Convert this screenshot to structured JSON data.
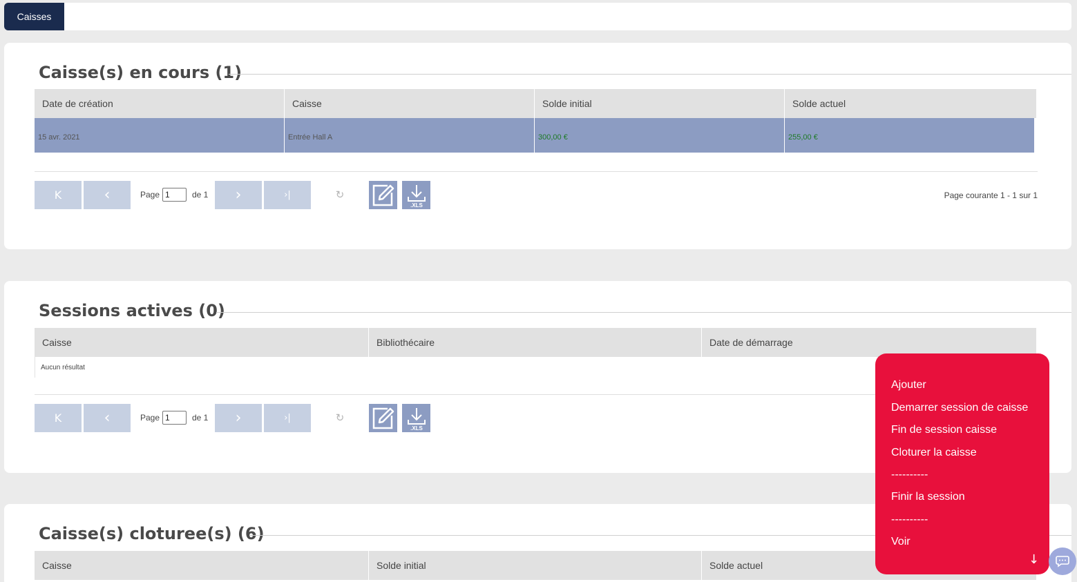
{
  "topbar": {
    "tab_label": "Caisses"
  },
  "panel1": {
    "title": "Caisse(s) en cours (1)",
    "columns": [
      "Date de création",
      "Caisse",
      "Solde initial",
      "Solde actuel"
    ],
    "rows": [
      [
        "15 avr. 2021",
        "Entrée Hall A",
        "300,00 €",
        "255,00 €"
      ]
    ],
    "pager": {
      "page_label": "Page",
      "page_value": "1",
      "of_label": "de 1",
      "info": "Page courante 1 - 1 sur 1"
    }
  },
  "panel2": {
    "title": "Sessions actives (0)",
    "columns": [
      "Caisse",
      "Bibliothécaire",
      "Date de démarrage"
    ],
    "empty_text": "Aucun résultat",
    "pager": {
      "page_label": "Page",
      "page_value": "1",
      "of_label": "de 1"
    }
  },
  "panel3": {
    "title": "Caisse(s) cloturee(s) (6)",
    "columns": [
      "Caisse",
      "Solde initial",
      "Solde actuel"
    ]
  },
  "pager_icons": {
    "first": "K",
    "prev": "‹",
    "next": "›",
    "last": "›|",
    "refresh": "↻",
    "xls_label": ".XLS"
  },
  "context_menu": {
    "items": [
      "Ajouter",
      "Demarrer session de caisse",
      "Fin de session caisse",
      "Cloturer la caisse",
      "----------",
      "Finir la session",
      "----------",
      "Voir"
    ],
    "scroll_icon": "↓"
  },
  "colors": {
    "tab_active": "#1a2b4e",
    "selected_row": "#8c9cc2",
    "money": "#1e7a26",
    "menu": "#e8103c",
    "pager_button": "#c6d0e2"
  }
}
